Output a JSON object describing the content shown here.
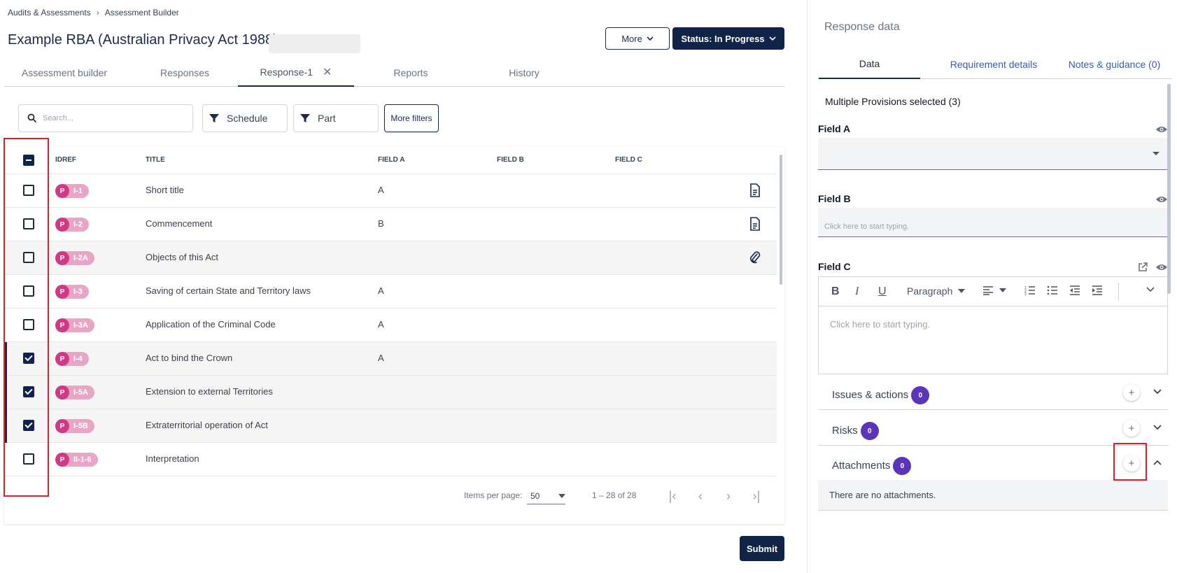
{
  "breadcrumb": {
    "root": "Audits & Assessments",
    "current": "Assessment Builder"
  },
  "page_title": "Example RBA (Australian Privacy Act 1988)",
  "header": {
    "more_label": "More",
    "status_label": "Status: In Progress"
  },
  "tabs": [
    {
      "label": "Assessment builder"
    },
    {
      "label": "Responses"
    },
    {
      "label": "Response-1"
    },
    {
      "label": "Reports"
    },
    {
      "label": "History"
    }
  ],
  "search": {
    "placeholder": "Search..."
  },
  "filters": {
    "schedule": "Schedule",
    "part": "Part",
    "more_filters": "More filters"
  },
  "table": {
    "headers": {
      "idref": "IDREF",
      "title": "TITLE",
      "field_a": "FIELD A",
      "field_b": "FIELD B",
      "field_c": "FIELD C"
    },
    "chip_prefix": "P",
    "rows": [
      {
        "id": "I-1",
        "title": "Short title",
        "field_a": "A",
        "checked": false,
        "icon": "document-icon"
      },
      {
        "id": "I-2",
        "title": "Commencement",
        "field_a": "B",
        "checked": false,
        "icon": "document-icon"
      },
      {
        "id": "I-2A",
        "title": "Objects of this Act",
        "field_a": "",
        "checked": false,
        "icon": "paperclip-icon"
      },
      {
        "id": "I-3",
        "title": "Saving of certain State and Territory laws",
        "field_a": "A",
        "checked": false,
        "icon": ""
      },
      {
        "id": "I-3A",
        "title": "Application of the Criminal Code",
        "field_a": "A",
        "checked": false,
        "icon": ""
      },
      {
        "id": "I-4",
        "title": "Act to bind the Crown",
        "field_a": "A",
        "checked": true,
        "icon": ""
      },
      {
        "id": "I-5A",
        "title": "Extension to external Territories",
        "field_a": "",
        "checked": true,
        "icon": ""
      },
      {
        "id": "I-5B",
        "title": "Extraterritorial operation of Act",
        "field_a": "",
        "checked": true,
        "icon": ""
      },
      {
        "id": "II-1-6",
        "title": "Interpretation",
        "field_a": "",
        "checked": false,
        "icon": ""
      }
    ]
  },
  "pager": {
    "items_per_page_label": "Items per page:",
    "items_per_page": "50",
    "range": "1 – 28 of 28"
  },
  "submit_label": "Submit",
  "response_panel": {
    "title": "Response data",
    "tabs": [
      {
        "label": "Data"
      },
      {
        "label": "Requirement details"
      },
      {
        "label": "Notes & guidance (0)"
      }
    ],
    "multi_selected": "Multiple Provisions selected (3)",
    "field_a": {
      "label": "Field A"
    },
    "field_b": {
      "label": "Field B",
      "placeholder": "Click here to start typing."
    },
    "field_c": {
      "label": "Field C",
      "paragraph": "Paragraph",
      "placeholder": "Click here to start typing."
    },
    "sections": [
      {
        "label": "Issues & actions",
        "count": "0"
      },
      {
        "label": "Risks",
        "count": "0"
      },
      {
        "label": "Attachments",
        "count": "0"
      }
    ],
    "attachments_empty": "There are no attachments."
  },
  "colors": {
    "navy": "#0f2447",
    "chip_dark": "#cf3a84",
    "chip_light": "#e8a6c6",
    "badge": "#5b35b9",
    "highlight": "#e11d2a"
  }
}
